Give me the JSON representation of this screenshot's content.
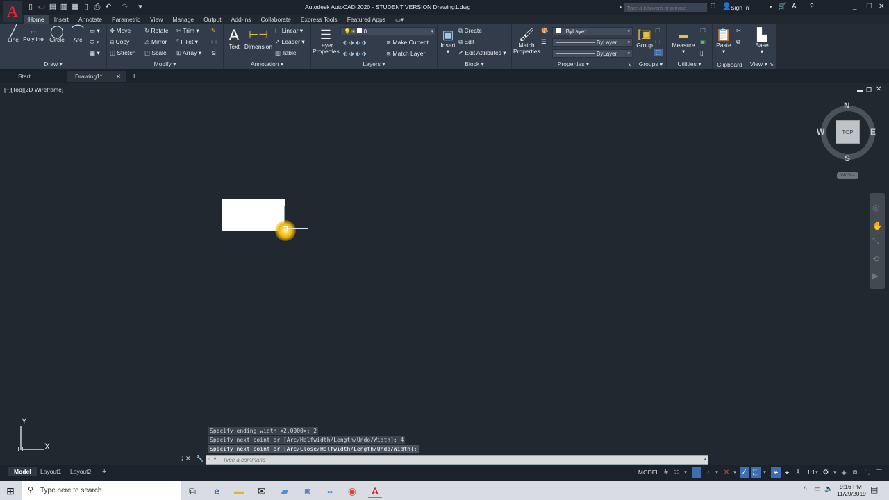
{
  "window": {
    "title": "Autodesk AutoCAD 2020 - STUDENT VERSION    Drawing1.dwg",
    "app_logo": "A",
    "search_placeholder": "Type a keyword or phrase",
    "sign_in": "Sign In",
    "quick_access": [
      "new-icon",
      "open-icon",
      "save-icon",
      "save-as-icon",
      "plot-icon",
      "publish-icon",
      "print-icon",
      "undo-icon",
      "redo-icon",
      "customize-icon"
    ]
  },
  "ribbon_tabs": [
    "Home",
    "Insert",
    "Annotate",
    "Parametric",
    "View",
    "Manage",
    "Output",
    "Add-ins",
    "Collaborate",
    "Express Tools",
    "Featured Apps"
  ],
  "ribbon": {
    "draw": {
      "label": "Draw",
      "line": "Line",
      "polyline": "Polyline",
      "circle": "Circle",
      "arc": "Arc"
    },
    "modify": {
      "label": "Modify",
      "move": "Move",
      "copy": "Copy",
      "stretch": "Stretch",
      "rotate": "Rotate",
      "mirror": "Mirror",
      "scale": "Scale",
      "trim": "Trim",
      "fillet": "Fillet",
      "array": "Array"
    },
    "annotation": {
      "label": "Annotation",
      "text": "Text",
      "dimension": "Dimension",
      "linear": "Linear",
      "leader": "Leader",
      "table": "Table"
    },
    "layers": {
      "label": "Layers",
      "layer_properties_1": "Layer",
      "layer_properties_2": "Properties",
      "current_layer": "0",
      "make_current": "Make Current",
      "match_layer": "Match Layer"
    },
    "block": {
      "label": "Block",
      "insert": "Insert",
      "create": "Create",
      "edit": "Edit",
      "edit_attributes": "Edit Attributes"
    },
    "properties": {
      "label": "Properties",
      "match_1": "Match",
      "match_2": "Properties",
      "color": "ByLayer",
      "linetype": "ByLayer",
      "lineweight": "ByLayer"
    },
    "groups": {
      "label": "Groups",
      "group": "Group"
    },
    "utilities": {
      "label": "Utilities",
      "measure": "Measure"
    },
    "clipboard": {
      "label": "Clipboard",
      "paste": "Paste"
    },
    "view": {
      "label": "View",
      "base": "Base"
    }
  },
  "file_tabs": {
    "start": "Start",
    "drawing": "Drawing1*"
  },
  "viewport": {
    "label": "[−][Top][2D Wireframe]",
    "viewcube": {
      "n": "N",
      "s": "S",
      "e": "E",
      "w": "W",
      "face": "TOP",
      "wcs": "WCS –"
    },
    "ucs": {
      "x": "X",
      "y": "Y"
    }
  },
  "command": {
    "history": [
      "Specify ending width <2.0000>: 2",
      "Specify next point or [Arc/Halfwidth/Length/Undo/Width]: 4",
      "Specify next point or [Arc/Close/Halfwidth/Length/Undo/Width]:"
    ],
    "placeholder": "Type a command"
  },
  "layout_tabs": [
    "Model",
    "Layout1",
    "Layout2"
  ],
  "status": {
    "model": "MODEL",
    "scale": "1:1"
  },
  "taskbar": {
    "search": "Type here to search",
    "time": "9:16 PM",
    "date": "11/29/2019"
  }
}
